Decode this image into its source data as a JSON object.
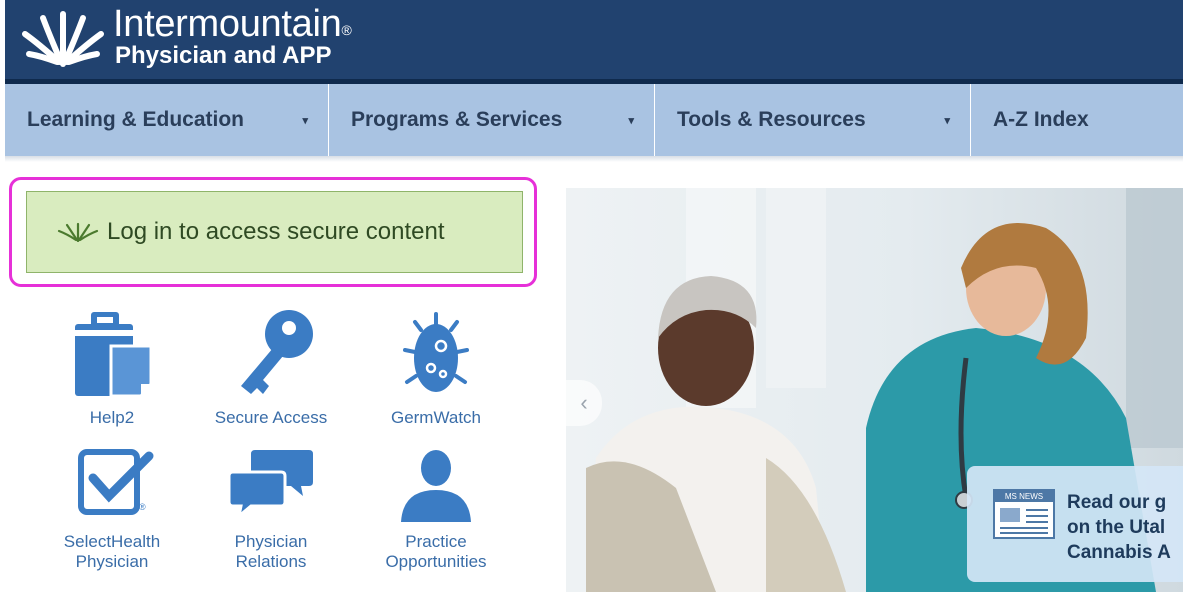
{
  "header": {
    "brand": "Intermountain",
    "trademark": "®",
    "subbrand": "Physician and APP",
    "colors": {
      "header_bg": "#21426f",
      "nav_bg": "#a9c3e2",
      "tile_blue": "#3b7cc4"
    }
  },
  "nav": {
    "items": [
      {
        "label": "Learning & Education",
        "caret": "▾"
      },
      {
        "label": "Programs & Services",
        "caret": "▾"
      },
      {
        "label": "Tools & Resources",
        "caret": "▾"
      },
      {
        "label": "A-Z Index"
      }
    ]
  },
  "login": {
    "label": "Log in to access secure content",
    "accent": "#e630d8"
  },
  "tiles": [
    {
      "label": "Help2",
      "icon": "clipboard-icon"
    },
    {
      "label": "Secure Access",
      "icon": "key-icon"
    },
    {
      "label": "GermWatch",
      "icon": "germ-icon"
    },
    {
      "label_lines": [
        "SelectHealth",
        "Physician"
      ],
      "icon": "checkmark-shield-icon"
    },
    {
      "label_lines": [
        "Physician",
        "Relations"
      ],
      "icon": "chat-bubbles-icon"
    },
    {
      "label_lines": [
        "Practice",
        "Opportunities"
      ],
      "icon": "person-icon"
    }
  ],
  "hero": {
    "prev_arrow": "‹",
    "news": {
      "icon_label": "MS NEWS",
      "lines": [
        "Read our g",
        "on the Utal",
        "Cannabis A"
      ]
    }
  }
}
